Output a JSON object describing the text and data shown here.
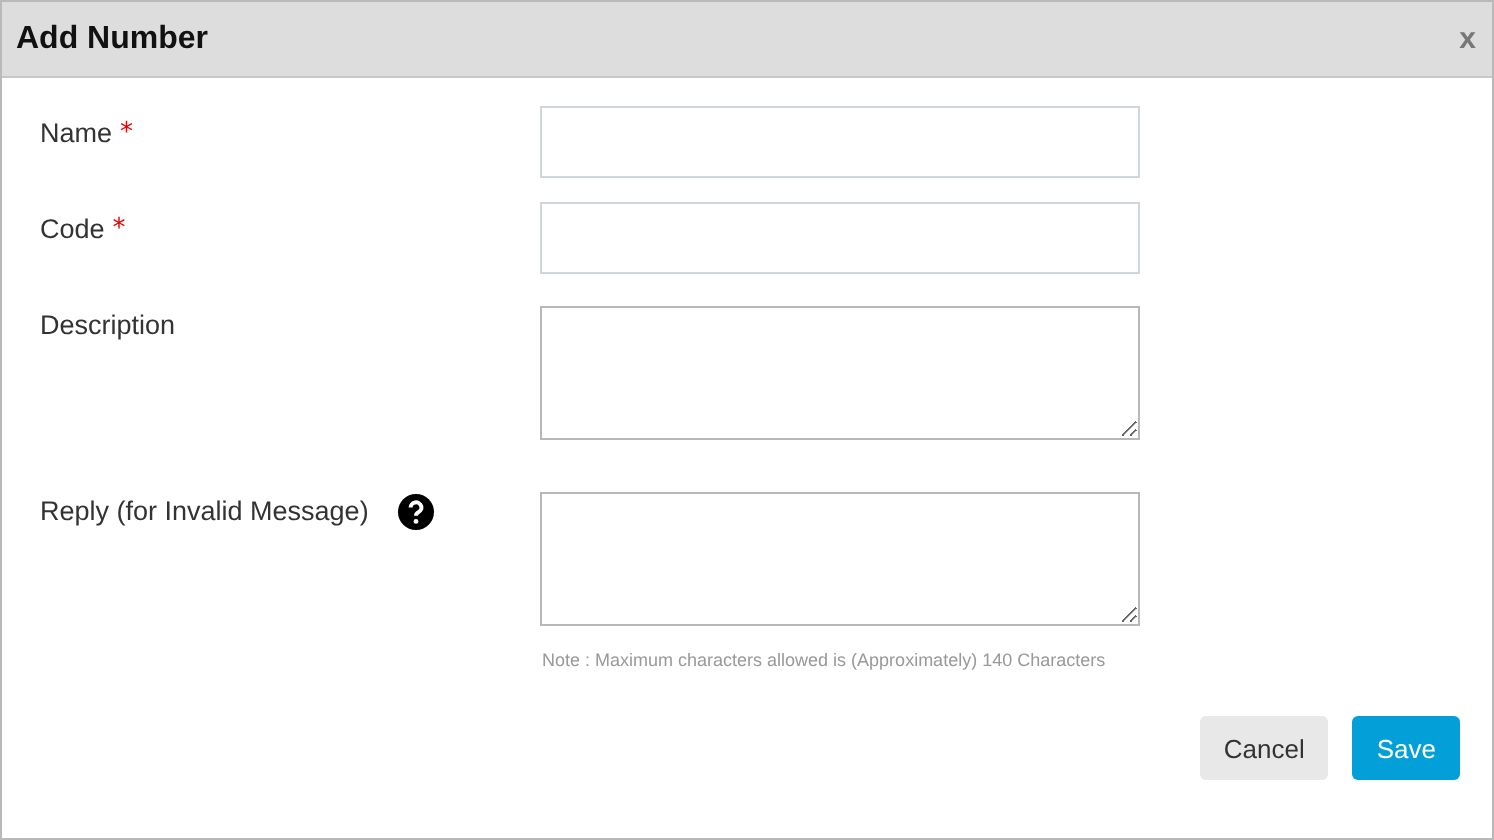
{
  "window": {
    "title": "Add Number",
    "close": "x"
  },
  "fields": [
    {
      "label": "Name",
      "required_mark": "*",
      "kind": "input",
      "help": false
    },
    {
      "label": "Code",
      "required_mark": "*",
      "kind": "input",
      "help": false
    },
    {
      "label": "Description",
      "kind": "textarea",
      "help": false
    },
    {
      "label": "Reply (for Invalid Message)",
      "kind": "textarea",
      "help": true
    }
  ],
  "note": "Note : Maximum characters allowed is (Approximately) 140 Characters",
  "buttons": [
    {
      "label": "Cancel",
      "kind": "secondary"
    },
    {
      "label": "Save",
      "kind": "primary"
    }
  ]
}
